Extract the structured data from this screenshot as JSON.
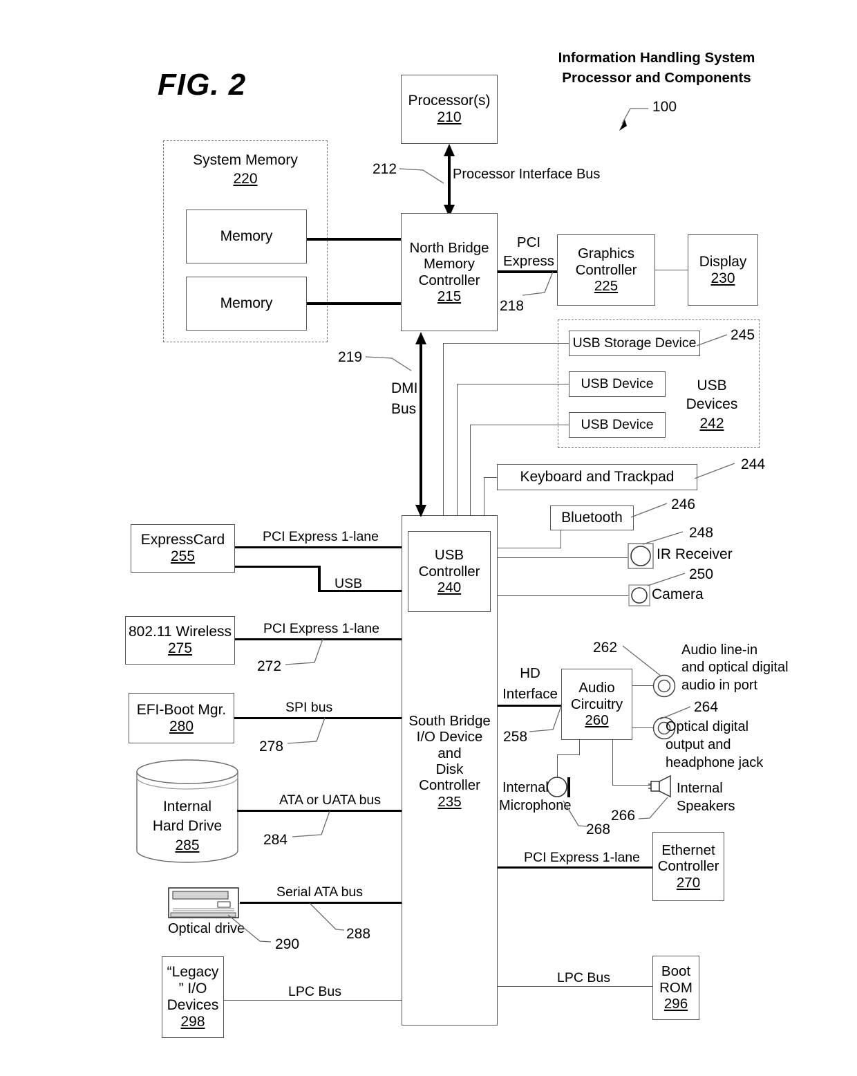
{
  "figure": {
    "label": "FIG. 2",
    "header_line1": "Information Handling System",
    "header_line2": "Processor and Components",
    "system_ref": "100"
  },
  "blocks": {
    "processor": {
      "label": "Processor(s)",
      "ref": "210"
    },
    "system_memory": {
      "label": "System Memory",
      "ref": "220"
    },
    "memory_1": {
      "label": "Memory"
    },
    "memory_2": {
      "label": "Memory"
    },
    "north_bridge": {
      "line1": "North Bridge",
      "line2": "Memory",
      "line3": "Controller",
      "ref": "215"
    },
    "graphics": {
      "line1": "Graphics",
      "line2": "Controller",
      "ref": "225"
    },
    "display": {
      "label": "Display",
      "ref": "230"
    },
    "usb_devices_group": {
      "line1": "USB",
      "line2": "Devices",
      "ref": "242"
    },
    "usb_storage": {
      "label": "USB Storage Device",
      "ref": "245"
    },
    "usb_device_1": {
      "label": "USB Device"
    },
    "usb_device_2": {
      "label": "USB Device"
    },
    "keyboard": {
      "label": "Keyboard and Trackpad",
      "ref": "244"
    },
    "bluetooth": {
      "label": "Bluetooth",
      "ref": "246"
    },
    "ir_receiver": {
      "label": "IR Receiver",
      "ref": "248"
    },
    "camera": {
      "label": "Camera",
      "ref": "250"
    },
    "usb_controller": {
      "line1": "USB",
      "line2": "Controller",
      "ref": "240"
    },
    "south_bridge": {
      "line1": "South Bridge",
      "line2": "I/O Device",
      "line3": "and",
      "line4": "Disk",
      "line5": "Controller",
      "ref": "235"
    },
    "expresscard": {
      "label": "ExpressCard",
      "ref": "255"
    },
    "wireless": {
      "label": "802.11 Wireless",
      "ref": "275"
    },
    "efi_boot": {
      "label": "EFI-Boot Mgr.",
      "ref": "280"
    },
    "hard_drive": {
      "line1": "Internal",
      "line2": "Hard Drive",
      "ref": "285"
    },
    "optical_drive": {
      "label": "Optical drive",
      "ref": "290"
    },
    "legacy_io": {
      "line1": "“Legacy",
      "line2": "” I/O",
      "line3": "Devices",
      "ref": "298"
    },
    "audio": {
      "line1": "Audio",
      "line2": "Circuitry",
      "ref": "260"
    },
    "audio_in_port": {
      "line1": "Audio line-in",
      "line2": "and optical digital",
      "line3": "audio in port",
      "ref": "262"
    },
    "audio_out_port": {
      "line1": "Optical digital",
      "line2": "output and",
      "line3": "headphone jack",
      "ref": "264"
    },
    "internal_mic": {
      "line1": "Internal",
      "line2": "Microphone",
      "ref": "268"
    },
    "internal_speakers": {
      "line1": "Internal",
      "line2": "Speakers",
      "ref": "266"
    },
    "ethernet": {
      "line1": "Ethernet",
      "line2": "Controller",
      "ref": "270"
    },
    "boot_rom": {
      "line1": "Boot",
      "line2": "ROM",
      "ref": "296"
    }
  },
  "buses": {
    "processor_interface": {
      "label": "Processor Interface Bus",
      "ref": "212"
    },
    "pci_express": {
      "line1": "PCI",
      "line2": "Express",
      "ref": "218"
    },
    "dmi": {
      "line1": "DMI",
      "line2": "Bus",
      "ref": "219"
    },
    "pcie_1lane_express": {
      "label": "PCI Express 1-lane"
    },
    "usb": {
      "label": "USB"
    },
    "pcie_1lane_wireless": {
      "label": "PCI Express 1-lane",
      "ref": "272"
    },
    "spi": {
      "label": "SPI bus",
      "ref": "278"
    },
    "ata": {
      "label": "ATA or UATA bus",
      "ref": "284"
    },
    "serial_ata": {
      "label": "Serial ATA bus",
      "ref": "288"
    },
    "lpc_left": {
      "label": "LPC Bus"
    },
    "lpc_right": {
      "label": "LPC Bus"
    },
    "hd_interface": {
      "line1": "HD",
      "line2": "Interface",
      "ref": "258"
    },
    "pcie_1lane_ethernet": {
      "label": "PCI Express 1-lane"
    }
  },
  "colors": {
    "ink": "#000000",
    "line": "#555555",
    "dashed": "#777777"
  }
}
